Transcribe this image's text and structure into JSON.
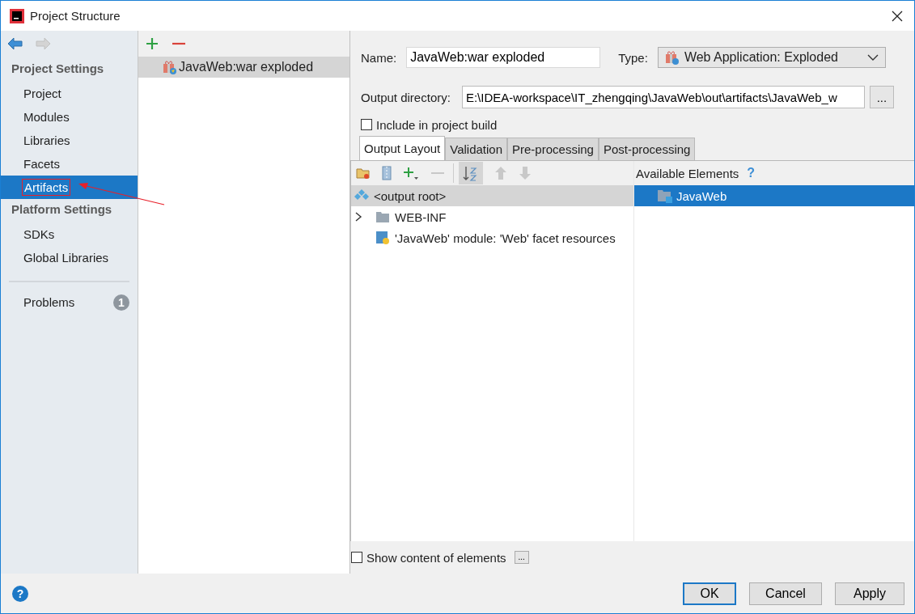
{
  "window": {
    "title": "Project Structure"
  },
  "sidebar": [
    {
      "kind": "header",
      "label": "Project Settings"
    },
    {
      "kind": "item",
      "label": "Project",
      "selected": false,
      "highlighted": false
    },
    {
      "kind": "item",
      "label": "Modules",
      "selected": false,
      "highlighted": false
    },
    {
      "kind": "item",
      "label": "Libraries",
      "selected": false,
      "highlighted": false
    },
    {
      "kind": "item",
      "label": "Facets",
      "selected": false,
      "highlighted": false
    },
    {
      "kind": "item",
      "label": "Artifacts",
      "selected": true,
      "highlighted": true
    },
    {
      "kind": "header",
      "label": "Platform Settings"
    },
    {
      "kind": "item",
      "label": "SDKs",
      "selected": false,
      "highlighted": false
    },
    {
      "kind": "item",
      "label": "Global Libraries",
      "selected": false,
      "highlighted": false
    },
    {
      "kind": "problems",
      "label": "Problems",
      "badge": "1"
    }
  ],
  "artifacts": [
    {
      "label": "JavaWeb:war exploded",
      "selected": true
    }
  ],
  "form": {
    "name_label": "Name:",
    "name_value": "JavaWeb:war exploded",
    "type_label": "Type:",
    "type_value": "Web Application: Exploded",
    "output_label": "Output directory:",
    "output_value": "E:\\IDEA-workspace\\IT_zhengqing\\JavaWeb\\out\\artifacts\\JavaWeb_w",
    "browse": "...",
    "include_label": "Include in project build",
    "include_checked": false
  },
  "tabs": [
    {
      "label": "Output Layout",
      "selected": true
    },
    {
      "label": "Validation",
      "selected": false
    },
    {
      "label": "Pre-processing",
      "selected": false
    },
    {
      "label": "Post-processing",
      "selected": false
    }
  ],
  "layout_tree": [
    {
      "label": "<output root>",
      "kind": "root",
      "selected": true
    },
    {
      "label": "WEB-INF",
      "kind": "folder",
      "expanded": false,
      "selected": false
    },
    {
      "label": "'JavaWeb' module: 'Web' facet resources",
      "kind": "module",
      "selected": false
    }
  ],
  "available": {
    "title": "Available Elements",
    "help": "?",
    "items": [
      {
        "label": "JavaWeb",
        "selected": true
      }
    ]
  },
  "show_content": {
    "label": "Show content of elements",
    "checked": false,
    "more": "..."
  },
  "buttons": [
    {
      "label": "OK",
      "default": true
    },
    {
      "label": "Cancel",
      "default": false
    },
    {
      "label": "Apply",
      "default": false
    }
  ],
  "help": "?"
}
